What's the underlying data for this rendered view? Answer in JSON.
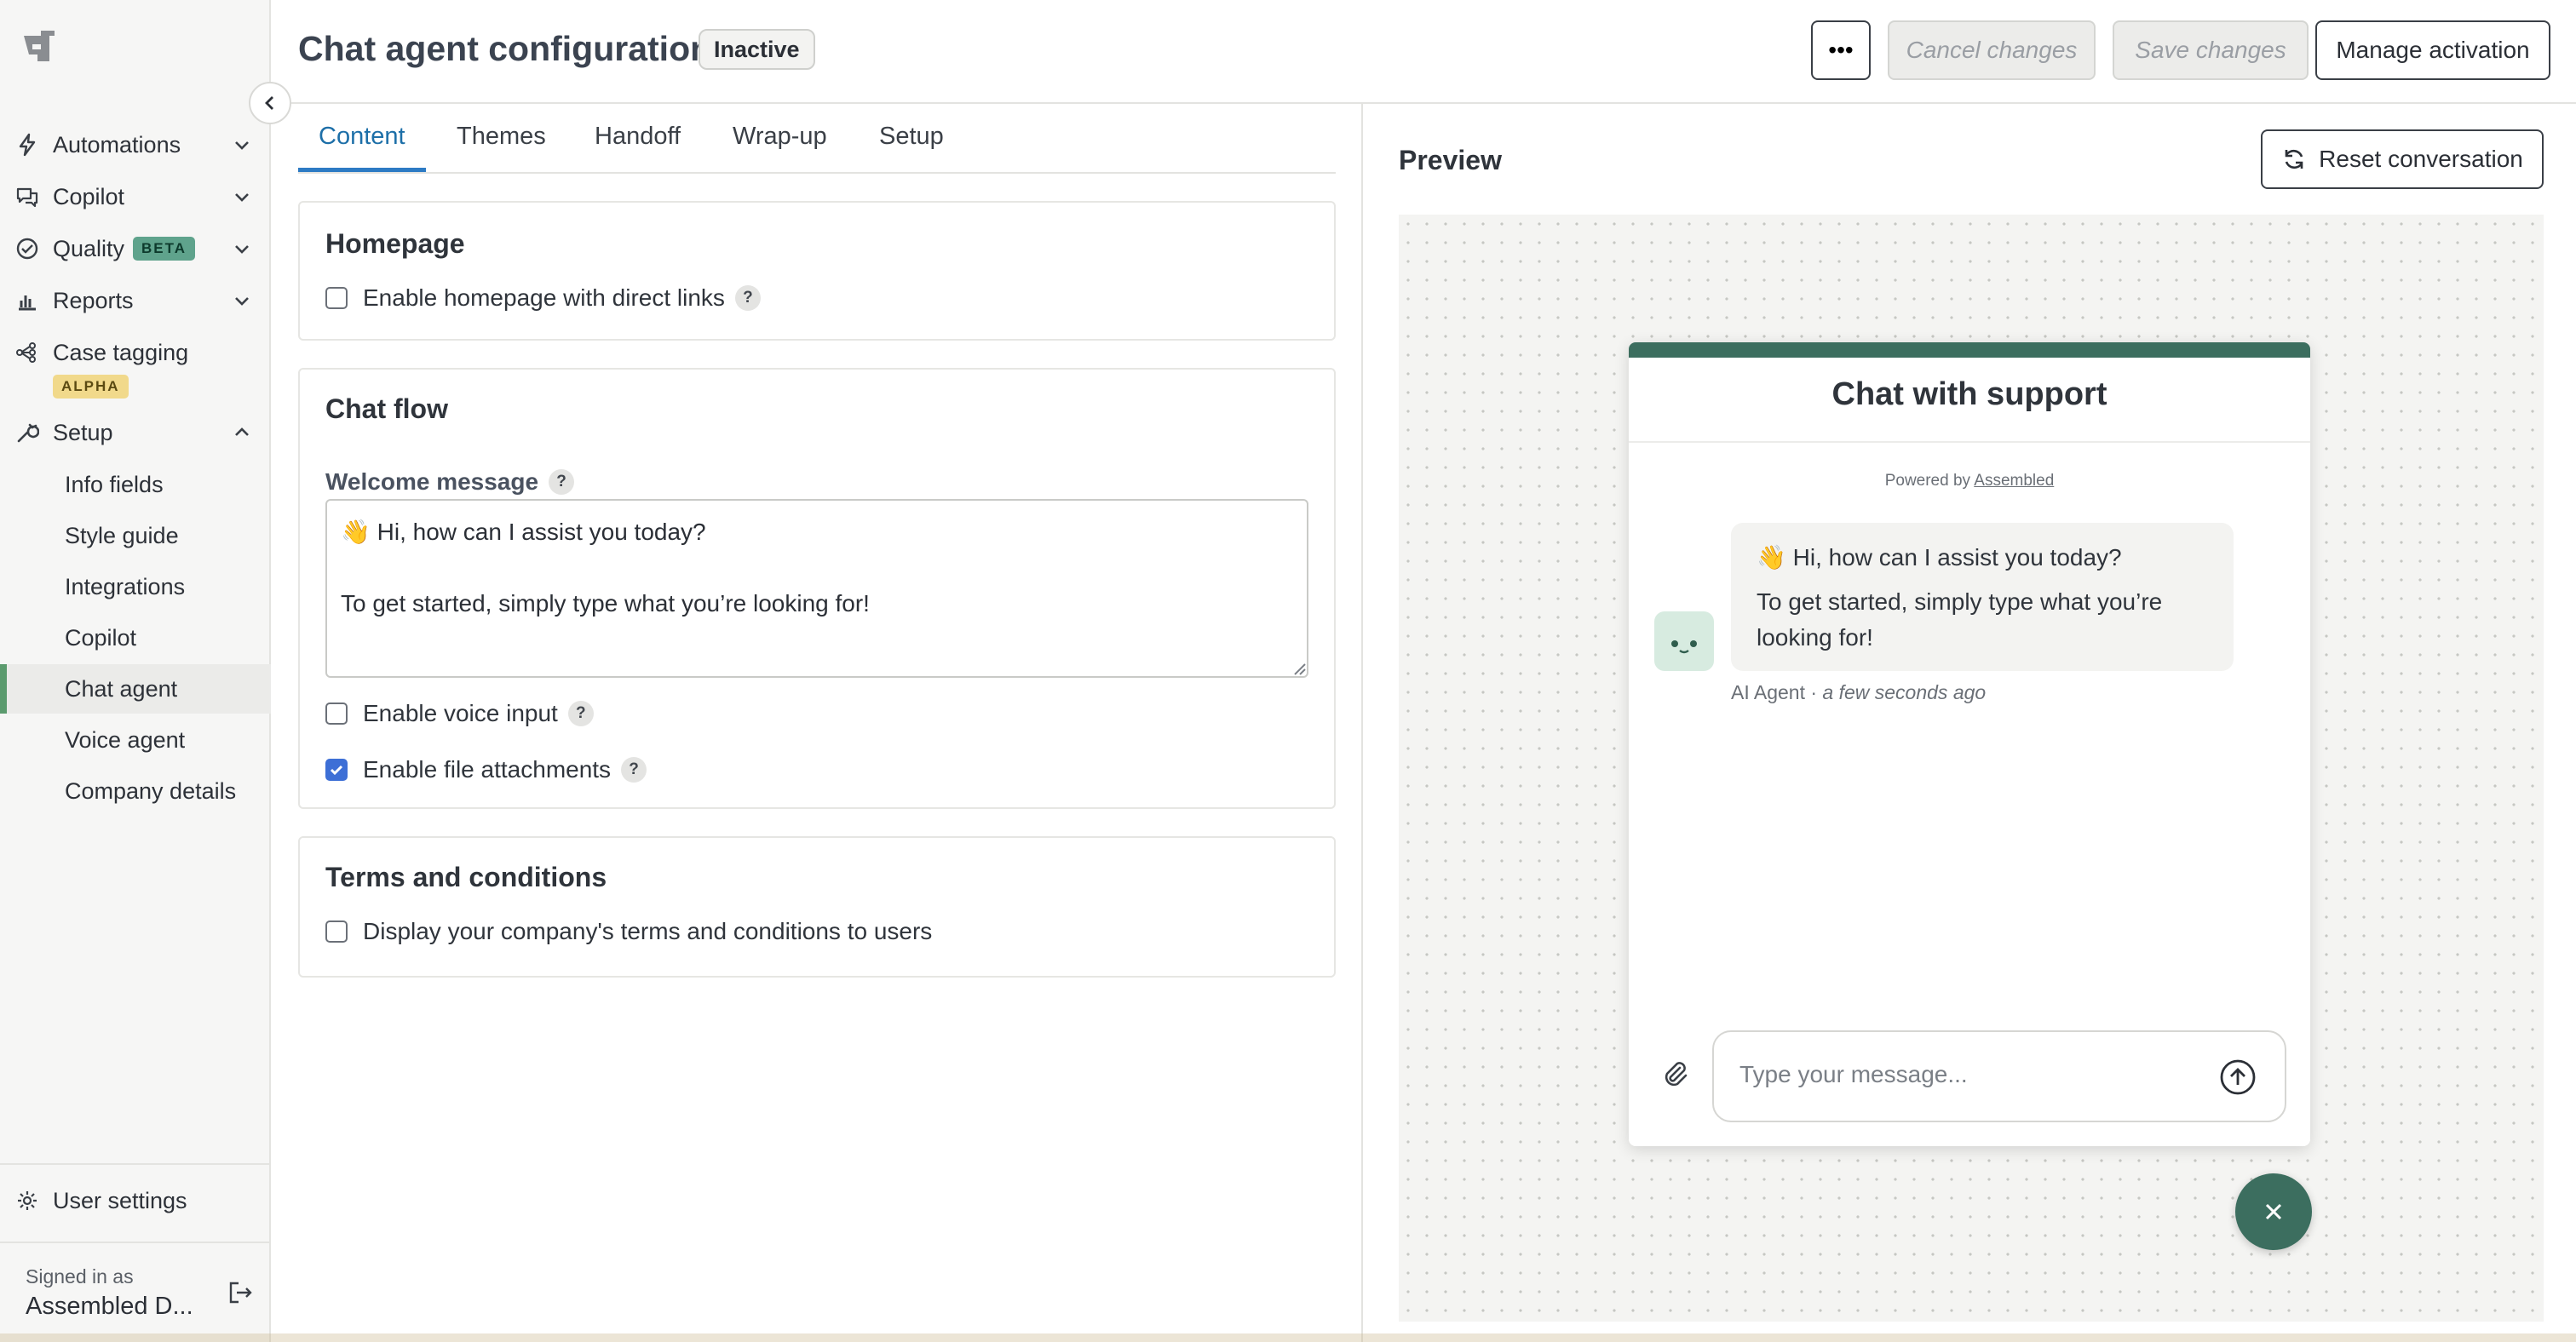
{
  "sidebar": {
    "logo_icon": "assembled-logo-icon",
    "collapse_icon": "chevron-left-icon",
    "items": [
      {
        "label": "Automations",
        "icon": "bolt-icon",
        "chevron": "chevron-down-icon"
      },
      {
        "label": "Copilot",
        "icon": "chat-bubbles-icon",
        "chevron": "chevron-down-icon"
      },
      {
        "label": "Quality",
        "icon": "check-circle-icon",
        "chevron": "chevron-down-icon",
        "badge": "BETA"
      },
      {
        "label": "Reports",
        "icon": "bar-chart-icon",
        "chevron": "chevron-down-icon"
      },
      {
        "label": "Case tagging",
        "icon": "tag-tree-icon",
        "badge": "ALPHA"
      },
      {
        "label": "Setup",
        "icon": "wrench-icon",
        "chevron": "chevron-up-icon"
      }
    ],
    "setup_subitems": [
      {
        "label": "Info fields"
      },
      {
        "label": "Style guide"
      },
      {
        "label": "Integrations"
      },
      {
        "label": "Copilot"
      },
      {
        "label": "Chat agent",
        "active": true
      },
      {
        "label": "Voice agent"
      },
      {
        "label": "Company details"
      }
    ],
    "user_settings": {
      "label": "User settings",
      "icon": "gear-icon"
    },
    "signed_in": {
      "label": "Signed in as",
      "name": "Assembled D...",
      "logout_icon": "logout-icon"
    }
  },
  "header": {
    "title": "Chat agent configuration",
    "status": "Inactive",
    "more_label": "•••",
    "cancel_label": "Cancel changes",
    "save_label": "Save changes",
    "activation_label": "Manage activation"
  },
  "tabs": [
    {
      "label": "Content",
      "active": true
    },
    {
      "label": "Themes"
    },
    {
      "label": "Handoff"
    },
    {
      "label": "Wrap-up"
    },
    {
      "label": "Setup"
    }
  ],
  "homepage": {
    "title": "Homepage",
    "enable_label": "Enable homepage with direct links",
    "enable_checked": false,
    "help": "?"
  },
  "chat_flow": {
    "title": "Chat flow",
    "welcome_label": "Welcome message",
    "welcome_help": "?",
    "welcome_value": "👋 Hi, how can I assist you today?\n\nTo get started, simply type what you’re looking for!",
    "voice_label": "Enable voice input",
    "voice_checked": false,
    "voice_help": "?",
    "file_label": "Enable file attachments",
    "file_checked": true,
    "file_help": "?"
  },
  "terms": {
    "title": "Terms and conditions",
    "display_label": "Display your company's terms and conditions to users",
    "display_checked": false
  },
  "preview": {
    "title": "Preview",
    "reset_label": "Reset conversation",
    "reset_icon": "refresh-icon",
    "chat": {
      "title": "Chat with support",
      "powered_prefix": "Powered by",
      "powered_brand": "Assembled",
      "message_line1": "👋 Hi, how can I assist you today?",
      "message_line2": "To get started, simply type what you’re looking for!",
      "sender": "AI Agent · ",
      "timestamp": "a few seconds ago",
      "input_placeholder": "Type your message...",
      "attach_icon": "paperclip-icon",
      "send_icon": "send-arrow-icon",
      "close_icon": "close-icon"
    }
  },
  "colors": {
    "brand_green": "#3c6e5f",
    "tab_active": "#2d7bc4",
    "checkbox_checked": "#3d6fd6",
    "beta_badge": "#5fa38c",
    "alpha_badge": "#f1d98b",
    "active_marker": "#5b9b6e"
  }
}
